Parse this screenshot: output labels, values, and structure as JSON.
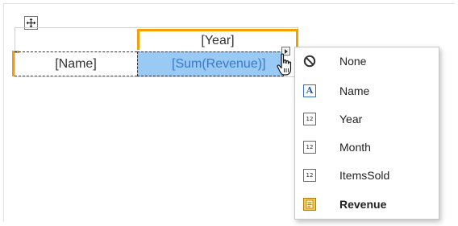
{
  "table": {
    "header_cell": "[Year]",
    "row_cell": "[Name]",
    "data_cell": "[Sum(Revenue)]"
  },
  "menu": {
    "items": [
      {
        "label": "None",
        "icon": "none-icon",
        "bold": false
      },
      {
        "label": "Name",
        "icon": "text-field-icon",
        "bold": false
      },
      {
        "label": "Year",
        "icon": "number-field-icon",
        "bold": false
      },
      {
        "label": "Month",
        "icon": "number-field-icon",
        "bold": false
      },
      {
        "label": "ItemsSold",
        "icon": "number-field-icon",
        "bold": false
      },
      {
        "label": "Revenue",
        "icon": "currency-field-icon",
        "bold": true
      }
    ],
    "number_icon_text": "12",
    "text_icon_text": "A"
  },
  "colors": {
    "selection_orange": "#f5a000",
    "cell_highlight": "#99c9f5",
    "cell_text_blue": "#3a78c8"
  }
}
